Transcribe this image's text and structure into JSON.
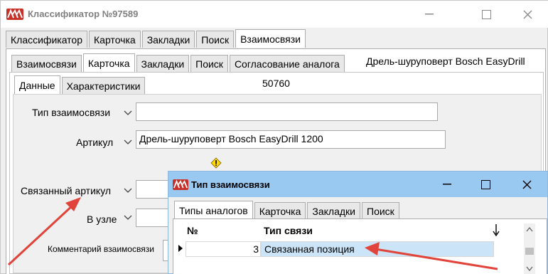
{
  "window": {
    "title": "Классификатор №97589",
    "minimize_glyph": "—",
    "maximize_glyph": "☐",
    "close_glyph": "✕"
  },
  "main_tabs": [
    {
      "label": "Классификатор"
    },
    {
      "label": "Карточка"
    },
    {
      "label": "Закладки"
    },
    {
      "label": "Поиск"
    },
    {
      "label": "Взаимосвязи",
      "active": true
    }
  ],
  "sub_tabs": [
    {
      "label": "Взаимосвязи"
    },
    {
      "label": "Карточка",
      "active": true
    },
    {
      "label": "Закладки"
    },
    {
      "label": "Поиск"
    },
    {
      "label": "Согласование аналога"
    }
  ],
  "product_title": "Дрель-шуруповерт Bosch EasyDrill",
  "card_tabs": [
    {
      "label": "Данные",
      "active": true
    },
    {
      "label": "Характеристики"
    }
  ],
  "record_id": "50760",
  "form": {
    "relation_type_label": "Тип взаимосвязи",
    "relation_type_value": "",
    "article_label": "Артикул",
    "article_value": "Дрель-шуруповерт Bosch EasyDrill 1200",
    "linked_article_label": "Связанный артикул",
    "linked_article_value": "",
    "node_label": "В узле",
    "node_value": "",
    "comment_label": "Комментарий взаимосвязи"
  },
  "child_window": {
    "title": "Тип взаимосвязи",
    "minimize_glyph": "—",
    "maximize_glyph": "☐",
    "close_glyph": "✕",
    "tabs": [
      {
        "label": "Типы аналогов",
        "active": true
      },
      {
        "label": "Карточка"
      },
      {
        "label": "Закладки"
      },
      {
        "label": "Поиск"
      }
    ],
    "grid": {
      "columns": [
        "№",
        "Тип связи"
      ],
      "rows": [
        {
          "num": "3",
          "type": "Связанная позиция"
        }
      ]
    }
  },
  "colors": {
    "accent_red": "#e0443a",
    "logo_red": "#c8302a",
    "child_titlebar": "#99c8f0",
    "selected_cell": "#cce4f7"
  },
  "icons": {
    "app": "app-logo-icon",
    "warning": "warning-icon",
    "row_pointer": "row-pointer-icon",
    "sort": "sort-down-arrow-icon"
  }
}
